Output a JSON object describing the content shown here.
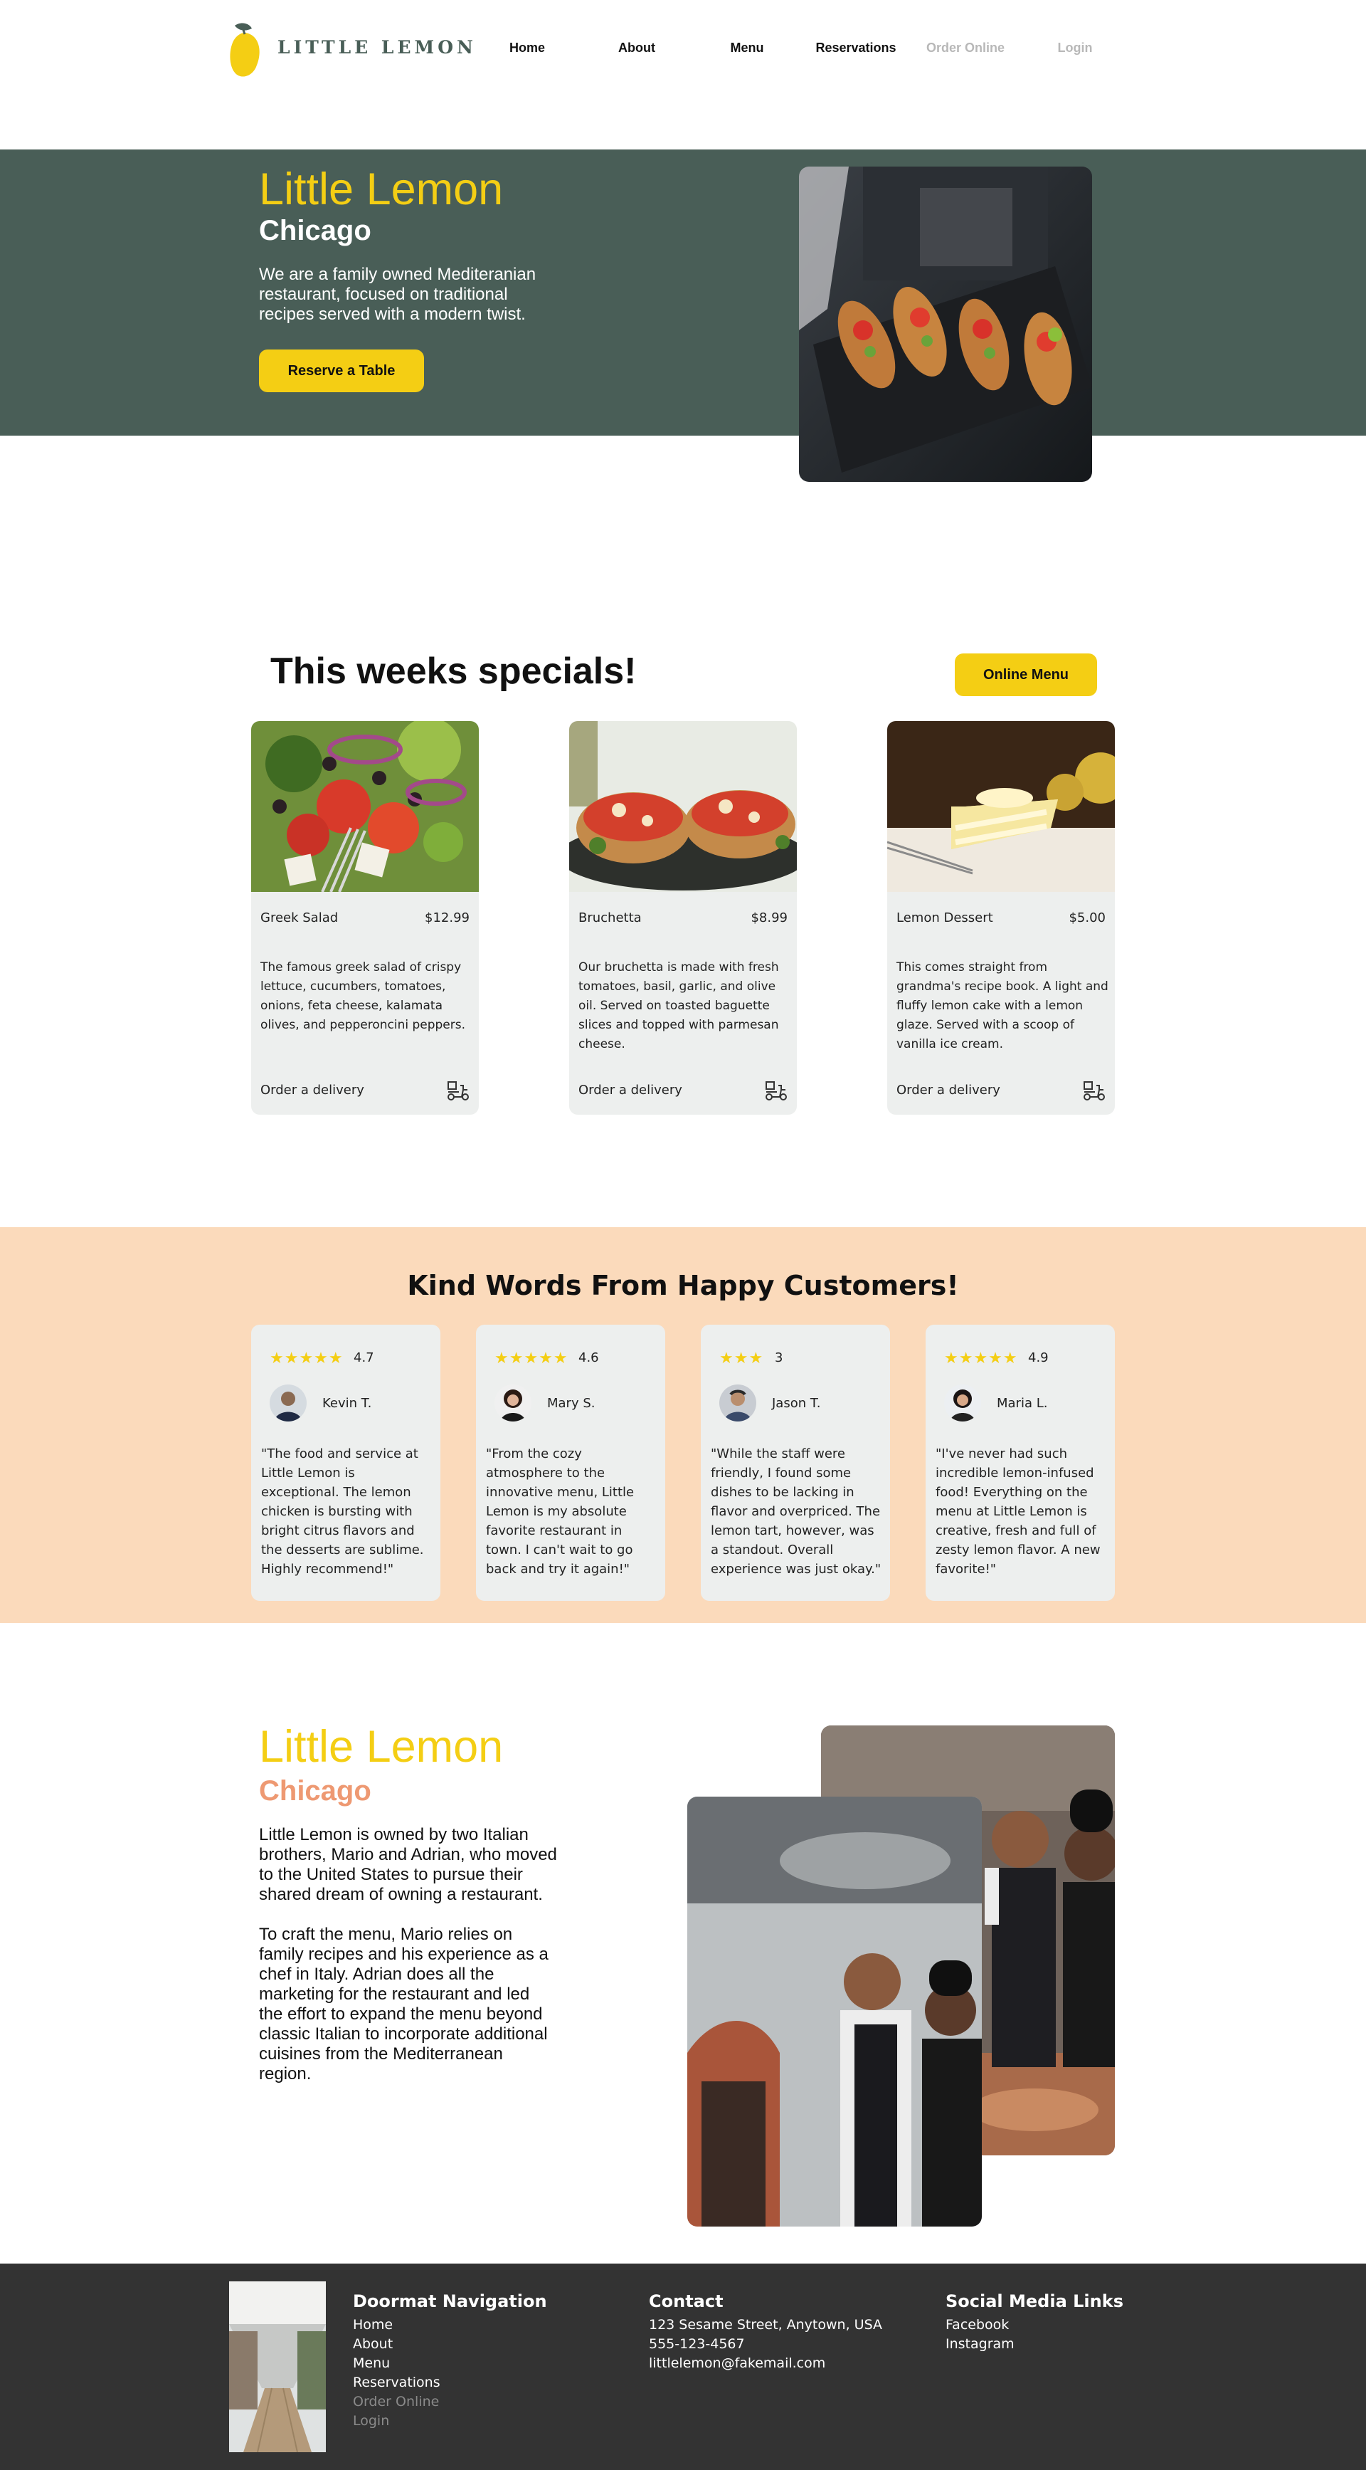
{
  "nav": {
    "logo_text": "LITTLE LEMON",
    "links": [
      "Home",
      "About",
      "Menu",
      "Reservations",
      "Order Online",
      "Login"
    ]
  },
  "hero": {
    "title": "Little Lemon",
    "subtitle": "Chicago",
    "description": "We are a family owned Mediteranian restaurant, focused on traditional recipes served with a modern twist.",
    "button": "Reserve a Table"
  },
  "specials": {
    "title": "This weeks specials!",
    "button": "Online Menu",
    "cards": [
      {
        "name": "Greek Salad",
        "price": "$12.99",
        "description": "The famous greek salad of crispy lettuce, cucumbers, tomatoes, onions, feta cheese, kalamata olives, and pepperoncini peppers.",
        "order": "Order a delivery"
      },
      {
        "name": "Bruchetta",
        "price": "$8.99",
        "description": "Our bruchetta is made with fresh tomatoes, basil, garlic, and olive oil. Served on toasted baguette slices and topped with parmesan cheese.",
        "order": "Order a delivery"
      },
      {
        "name": "Lemon Dessert",
        "price": "$5.00",
        "description": "This comes straight from grandma's recipe book. A light and fluffy lemon cake with a lemon glaze. Served with a scoop of vanilla ice cream.",
        "order": "Order a delivery"
      }
    ]
  },
  "testimonials": {
    "title": "Kind Words From Happy Customers!",
    "items": [
      {
        "stars": "★★★★★",
        "rating": "4.7",
        "name": "Kevin T.",
        "quote": "\"The food and service at Little Lemon is exceptional. The lemon chicken is bursting with bright citrus flavors and the desserts are sublime. Highly recommend!\""
      },
      {
        "stars": "★★★★★",
        "rating": "4.6",
        "name": "Mary S.",
        "quote": "\"From the cozy atmosphere to the innovative menu, Little Lemon is my absolute favorite restaurant in town. I can't wait to go back and try it again!\""
      },
      {
        "stars": "★★★",
        "rating": "3",
        "name": "Jason T.",
        "quote": "\"While the staff were friendly, I found some dishes to be lacking in flavor and overpriced. The lemon tart, however, was a standout. Overall experience was just okay.\""
      },
      {
        "stars": "★★★★★",
        "rating": "4.9",
        "name": "Maria L.",
        "quote": "\"I've never had such incredible lemon-infused food! Everything on the menu at Little Lemon is creative, fresh and full of zesty lemon flavor. A new favorite!\""
      }
    ]
  },
  "about": {
    "title": "Little Lemon",
    "subtitle": "Chicago",
    "text": "Little Lemon is owned by two Italian brothers, Mario and Adrian, who moved to the United States to pursue their shared dream of owning a restaurant.\n\nTo craft the menu, Mario relies on family recipes and his experience as a chef in Italy. Adrian does all the marketing for the restaurant and led the effort to expand the menu beyond classic Italian to incorporate additional cuisines from the Mediterranean region."
  },
  "footer": {
    "nav_title": "Doormat Navigation",
    "nav_links": [
      "Home",
      "About",
      "Menu",
      "Reservations",
      "Order Online",
      "Login"
    ],
    "contact_title": "Contact",
    "contact_lines": [
      "123 Sesame Street, Anytown, USA",
      "555-123-4567",
      "littlelemon@fakemail.com"
    ],
    "social_title": "Social Media Links",
    "social_links": [
      "Facebook",
      "Instagram"
    ]
  },
  "colors": {
    "primary_green": "#495e57",
    "primary_yellow": "#f4ce14",
    "salmon": "#ee9972",
    "peach": "#fbdabb",
    "card_gray": "#edefee",
    "footer_dark": "#333333"
  }
}
